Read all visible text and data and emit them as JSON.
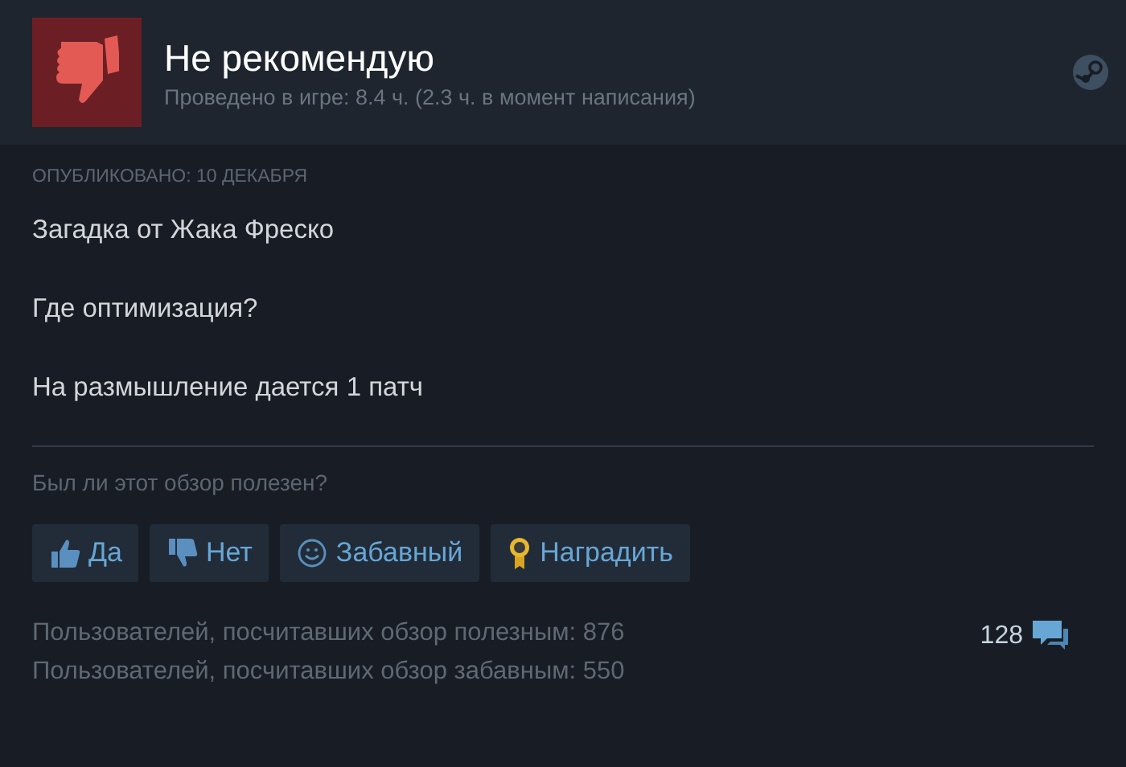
{
  "review": {
    "verdict": "Не рекомендую",
    "recommended": false,
    "playtime": "Проведено в игре: 8.4 ч. (2.3 ч. в момент написания)",
    "posted": "ОПУБЛИКОВАНО: 10 ДЕКАБРЯ",
    "paragraphs": [
      "Загадка от Жака Фреско",
      "Где оптимизация?",
      "На размышление дается 1 патч"
    ]
  },
  "feedback": {
    "question": "Был ли этот обзор полезен?",
    "buttons": [
      {
        "kind": "yes",
        "label": "Да"
      },
      {
        "kind": "no",
        "label": "Нет"
      },
      {
        "kind": "funny",
        "label": "Забавный"
      },
      {
        "kind": "award",
        "label": "Наградить"
      }
    ]
  },
  "stats": [
    "Пользователей, посчитавших обзор полезным: 876",
    "Пользователей, посчитавших обзор забавным: 550"
  ],
  "comments": {
    "count": "128"
  }
}
